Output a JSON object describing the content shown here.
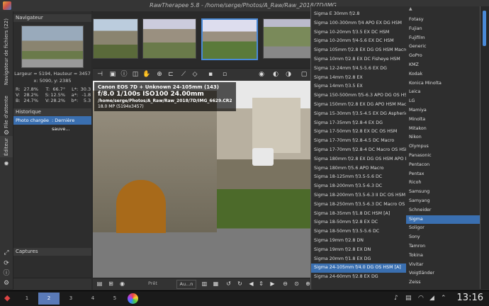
{
  "window": {
    "title": "RawTherapee 5.8 - /home/serge/Photos/A_Raw/Raw_2018/7D/IMG_"
  },
  "vtabs": {
    "file_browser": "Navigateur de fichiers (22)",
    "queue": "File d'attente",
    "editor": "Éditeur"
  },
  "navigator": {
    "header": "Navigateur",
    "size_line": "Largeur = 5194, Hauteur = 3457",
    "coord_line": "x: 5090, y: 2385",
    "rows": [
      {
        "a": "R:",
        "b": "27.8%",
        "c": "T:",
        "d": "66.7°",
        "e": "L*:",
        "f": "30.3"
      },
      {
        "a": "V:",
        "b": "28.2%",
        "c": "S:",
        "d": "12.5%",
        "e": "a*:",
        "f": "-1.8"
      },
      {
        "a": "B:",
        "b": "24.7%",
        "c": "V:",
        "d": "28.2%",
        "e": "b*:",
        "f": "5.3"
      }
    ]
  },
  "history": {
    "header": "Historique",
    "row_name": "Photo chargée",
    "row_value": ": Dernière sauve..."
  },
  "captures": {
    "header": "Captures"
  },
  "overlay": {
    "line1": "Canon EOS 7D + Unknown 24-105mm (143)",
    "line2": "f/8.0  1/100s  ISO100  24.00mm",
    "line3": "/home/serge/Photos/A_Raw/Raw_2018/7D/IMG_6629.CR2",
    "line4": "18.0 MP (5194x3457)"
  },
  "bottombar": {
    "preset_label": "Prêt",
    "auto_label": "Au...n"
  },
  "lenses": [
    "Sigma E 30mm f/2.8",
    "Sigma 100-300mm f/4 APO EX DG HSM",
    "Sigma 10-20mm f/3.5 EX DC HSM",
    "Sigma 10-20mm f/4-5.6 EX DC HSM",
    "Sigma 105mm f/2.8 EX DG OS HSM Macro",
    "Sigma 10mm f/2.8 EX DC Fisheye HSM",
    "Sigma 12-24mm f/4.5-5.6 EX DG",
    "Sigma 14mm f/2.8 EX",
    "Sigma 14mm f/3.5 EX",
    "Sigma 150-500mm f/5-6.3 APO DG OS HSM",
    "Sigma 150mm f/2.8 EX DG APO HSM Macro",
    "Sigma 15-30mm f/3.5-4.5 EX DG Aspherical",
    "Sigma 17-35mm f/2.8-4 EX DG",
    "Sigma 17-50mm f/2.8 EX DC OS HSM",
    "Sigma 17-70mm f/2.8-4.5 DC Macro",
    "Sigma 17-70mm f/2.8-4 DC Macro OS HSM",
    "Sigma 180mm f/2.8 EX DG OS HSM APO Macro",
    "Sigma 180mm f/5.6 APO Macro",
    "Sigma 18-125mm f/3.5-5.6 DC",
    "Sigma 18-200mm f/3.5-6.3 DC",
    "Sigma 18-200mm f/3.5-6.3 II DC OS HSM",
    "Sigma 18-250mm f/3.5-6.3 DC Macro OS HSM",
    "Sigma 18-35mm f/1.8 DC HSM [A]",
    "Sigma 18-50mm f/2.8 EX DC",
    "Sigma 18-50mm f/3.5-5.6 DC",
    "Sigma 19mm f/2.8 DN",
    "Sigma 19mm f/2.8 EX DN",
    "Sigma 20mm f/1.8 EX DG",
    "Sigma 24-105mm f/4.0 DG OS HSM [A]",
    "Sigma 24-60mm f/2.8 EX DG"
  ],
  "lens_selected_index": 28,
  "brands": [
    "Fotasy",
    "Fujian",
    "Fujifilm",
    "Generic",
    "GoPro",
    "KMZ",
    "Kodak",
    "Konica Minolta",
    "Leica",
    "LG",
    "Mamiya",
    "Minolta",
    "Mitakon",
    "Nikon",
    "Olympus",
    "Panasonic",
    "Pentacon",
    "Pentax",
    "Ricoh",
    "Samsung",
    "Samyang",
    "Schneider",
    "Sigma",
    "Soligor",
    "Sony",
    "Tamron",
    "Tokina",
    "Vivitar",
    "Voigtländer",
    "Zeiss"
  ],
  "brand_selected_index": 22,
  "taskbar": {
    "workspaces": [
      "1",
      "2",
      "3",
      "4",
      "5"
    ],
    "active_workspace": 1,
    "clock": "13:16"
  },
  "colors": {
    "accent": "#3a6fb0",
    "selection_border": "#4a8ad8"
  }
}
